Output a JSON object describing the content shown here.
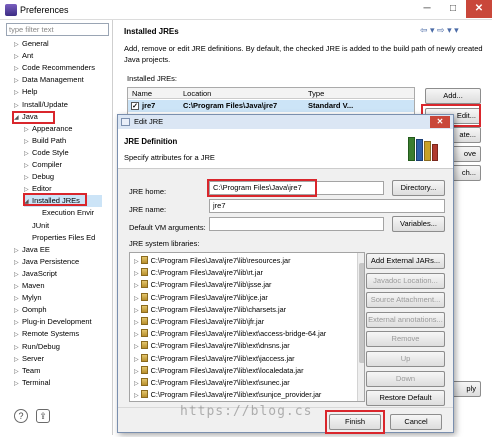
{
  "window": {
    "title": "Preferences"
  },
  "filter": {
    "placeholder": "type filter text"
  },
  "tree": [
    {
      "label": "General",
      "expander": "▷"
    },
    {
      "label": "Ant",
      "expander": "▷"
    },
    {
      "label": "Code Recommenders",
      "expander": "▷"
    },
    {
      "label": "Data Management",
      "expander": "▷"
    },
    {
      "label": "Help",
      "expander": "▷"
    },
    {
      "label": "Install/Update",
      "expander": "▷"
    },
    {
      "label": "Java",
      "expander": "◢"
    },
    {
      "label": "Appearance",
      "expander": "▷"
    },
    {
      "label": "Build Path",
      "expander": "▷"
    },
    {
      "label": "Code Style",
      "expander": "▷"
    },
    {
      "label": "Compiler",
      "expander": "▷"
    },
    {
      "label": "Debug",
      "expander": "▷"
    },
    {
      "label": "Editor",
      "expander": "▷"
    },
    {
      "label": "Installed JREs",
      "expander": "◢"
    },
    {
      "label": "Execution Envir",
      "expander": ""
    },
    {
      "label": "JUnit",
      "expander": ""
    },
    {
      "label": "Properties Files Ed",
      "expander": ""
    },
    {
      "label": "Java EE",
      "expander": "▷"
    },
    {
      "label": "Java Persistence",
      "expander": "▷"
    },
    {
      "label": "JavaScript",
      "expander": "▷"
    },
    {
      "label": "Maven",
      "expander": "▷"
    },
    {
      "label": "Mylyn",
      "expander": "▷"
    },
    {
      "label": "Oomph",
      "expander": "▷"
    },
    {
      "label": "Plug-in Development",
      "expander": "▷"
    },
    {
      "label": "Remote Systems",
      "expander": "▷"
    },
    {
      "label": "Run/Debug",
      "expander": "▷"
    },
    {
      "label": "Server",
      "expander": "▷"
    },
    {
      "label": "Team",
      "expander": "▷"
    },
    {
      "label": "Terminal",
      "expander": "▷"
    }
  ],
  "page": {
    "title": "Installed JREs",
    "description": "Add, remove or edit JRE definitions. By default, the checked JRE is added to the build path of newly created Java projects.",
    "installed_label": "Installed JREs:",
    "columns": [
      "Name",
      "Location",
      "Type"
    ],
    "row": {
      "name": "jre7",
      "location": "C:\\Program Files\\Java\\jre7",
      "type": "Standard V..."
    },
    "buttons": {
      "add": "Add...",
      "edit": "Edit...",
      "duplicate": "ate...",
      "remove": "ove",
      "search": "ch...",
      "apply": "ply"
    }
  },
  "dialog": {
    "title": "Edit JRE",
    "header_title": "JRE Definition",
    "header_subtitle": "Specify attributes for a JRE",
    "jre_home_label": "JRE home:",
    "jre_home_value": "C:\\Program Files\\Java\\jre7",
    "jre_name_label": "JRE name:",
    "jre_name_value": "jre7",
    "vm_args_label": "Default VM arguments:",
    "vm_args_value": "",
    "libraries_label": "JRE system libraries:",
    "directory_button": "Directory...",
    "variables_button": "Variables...",
    "libraries": [
      "C:\\Program Files\\Java\\jre7\\lib\\resources.jar",
      "C:\\Program Files\\Java\\jre7\\lib\\rt.jar",
      "C:\\Program Files\\Java\\jre7\\lib\\jsse.jar",
      "C:\\Program Files\\Java\\jre7\\lib\\jce.jar",
      "C:\\Program Files\\Java\\jre7\\lib\\charsets.jar",
      "C:\\Program Files\\Java\\jre7\\lib\\jfr.jar",
      "C:\\Program Files\\Java\\jre7\\lib\\ext\\access-bridge-64.jar",
      "C:\\Program Files\\Java\\jre7\\lib\\ext\\dnsns.jar",
      "C:\\Program Files\\Java\\jre7\\lib\\ext\\jaccess.jar",
      "C:\\Program Files\\Java\\jre7\\lib\\ext\\localedata.jar",
      "C:\\Program Files\\Java\\jre7\\lib\\ext\\sunec.jar",
      "C:\\Program Files\\Java\\jre7\\lib\\ext\\sunjce_provider.jar"
    ],
    "side_buttons": [
      "Add External JARs...",
      "Javadoc Location...",
      "Source Attachment...",
      "External annotations...",
      "Remove",
      "Up",
      "Down",
      "Restore Default"
    ],
    "finish": "Finish",
    "cancel": "Cancel"
  },
  "watermark": "https://blog.cs",
  "colors": {
    "highlight": "#d9262c",
    "selection": "#cce4f7"
  }
}
